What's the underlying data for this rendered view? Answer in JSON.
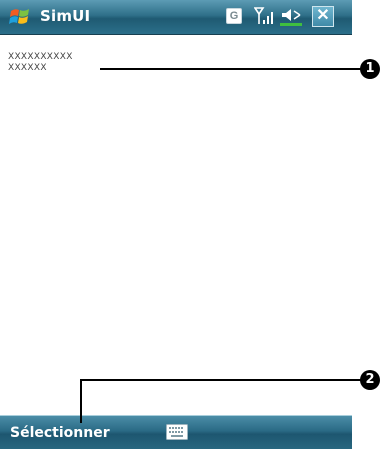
{
  "titlebar": {
    "app_title": "SimUI",
    "icons": [
      "windows-start-icon",
      "g-icon",
      "signal-icon",
      "volume-muted-icon",
      "close-icon"
    ],
    "g_label": "G",
    "close_label": "✕"
  },
  "content": {
    "lines": [
      "XXXXXXXXXX",
      "XXXXXX"
    ]
  },
  "bottombar": {
    "softkey_left": "Sélectionner",
    "keyboard_icon": "keyboard-icon"
  },
  "callouts": [
    {
      "number": "1"
    },
    {
      "number": "2"
    }
  ],
  "colors": {
    "bar_accent": "#2f7089",
    "bar_dark": "#1d5670",
    "callout": "#000000"
  }
}
